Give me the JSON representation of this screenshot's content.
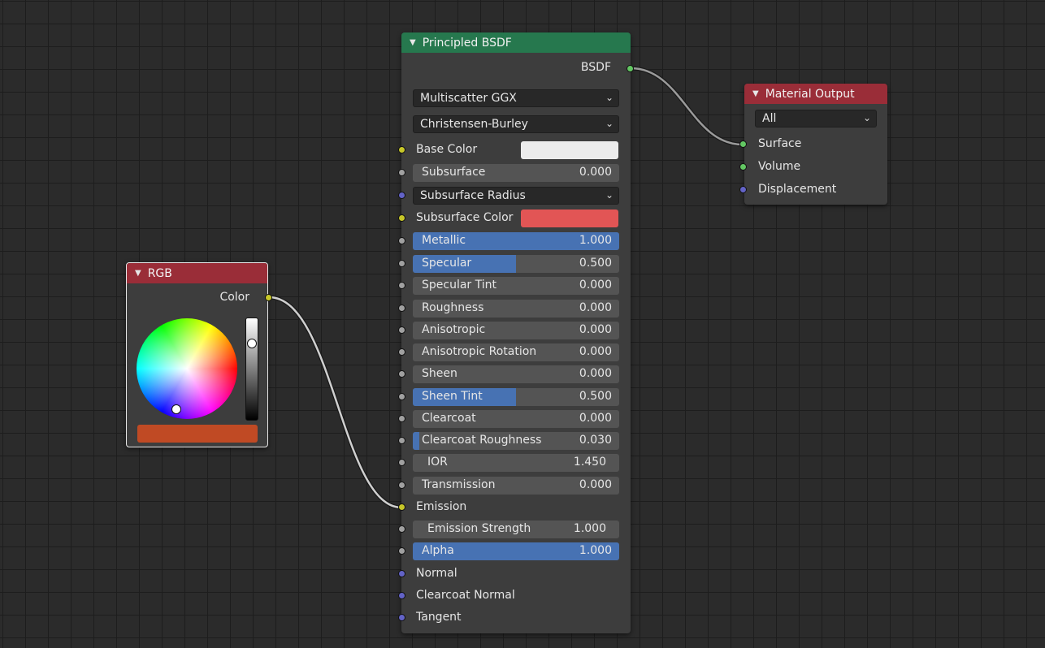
{
  "nodes": {
    "principled": {
      "title": "Principled BSDF",
      "header_color": "#26784e",
      "output_label": "BSDF",
      "distribution": "Multiscatter GGX",
      "subsurface_method": "Christensen-Burley",
      "inputs": [
        {
          "key": "base_color",
          "label": "Base Color",
          "kind": "color",
          "socket": "yellow",
          "color": "#ececec"
        },
        {
          "key": "subsurface",
          "label": "Subsurface",
          "kind": "slider",
          "socket": "grey",
          "value": "0.000",
          "fill": 0
        },
        {
          "key": "subsurface_radius",
          "label": "Subsurface Radius",
          "kind": "dropdown",
          "socket": "blue"
        },
        {
          "key": "subsurface_color",
          "label": "Subsurface Color",
          "kind": "color",
          "socket": "yellow",
          "color": "#e25555"
        },
        {
          "key": "metallic",
          "label": "Metallic",
          "kind": "slider",
          "socket": "grey",
          "value": "1.000",
          "fill": 1
        },
        {
          "key": "specular",
          "label": "Specular",
          "kind": "slider",
          "socket": "grey",
          "value": "0.500",
          "fill": 0.5
        },
        {
          "key": "specular_tint",
          "label": "Specular Tint",
          "kind": "slider",
          "socket": "grey",
          "value": "0.000",
          "fill": 0
        },
        {
          "key": "roughness",
          "label": "Roughness",
          "kind": "slider",
          "socket": "grey",
          "value": "0.000",
          "fill": 0
        },
        {
          "key": "anisotropic",
          "label": "Anisotropic",
          "kind": "slider",
          "socket": "grey",
          "value": "0.000",
          "fill": 0
        },
        {
          "key": "anisotropic_rotation",
          "label": "Anisotropic Rotation",
          "kind": "slider",
          "socket": "grey",
          "value": "0.000",
          "fill": 0
        },
        {
          "key": "sheen",
          "label": "Sheen",
          "kind": "slider",
          "socket": "grey",
          "value": "0.000",
          "fill": 0
        },
        {
          "key": "sheen_tint",
          "label": "Sheen Tint",
          "kind": "slider",
          "socket": "grey",
          "value": "0.500",
          "fill": 0.5
        },
        {
          "key": "clearcoat",
          "label": "Clearcoat",
          "kind": "slider",
          "socket": "grey",
          "value": "0.000",
          "fill": 0
        },
        {
          "key": "clearcoat_roughness",
          "label": "Clearcoat Roughness",
          "kind": "slider",
          "socket": "grey",
          "value": "0.030",
          "fill": 0.03
        },
        {
          "key": "ior",
          "label": "IOR",
          "kind": "number",
          "socket": "grey",
          "value": "1.450"
        },
        {
          "key": "transmission",
          "label": "Transmission",
          "kind": "slider",
          "socket": "grey",
          "value": "0.000",
          "fill": 0
        },
        {
          "key": "emission",
          "label": "Emission",
          "kind": "label",
          "socket": "yellow"
        },
        {
          "key": "emission_strength",
          "label": "Emission Strength",
          "kind": "number",
          "socket": "grey",
          "value": "1.000"
        },
        {
          "key": "alpha",
          "label": "Alpha",
          "kind": "slider",
          "socket": "grey",
          "value": "1.000",
          "fill": 1
        },
        {
          "key": "normal",
          "label": "Normal",
          "kind": "label",
          "socket": "blue"
        },
        {
          "key": "clearcoat_normal",
          "label": "Clearcoat Normal",
          "kind": "label",
          "socket": "blue"
        },
        {
          "key": "tangent",
          "label": "Tangent",
          "kind": "label",
          "socket": "blue"
        }
      ]
    },
    "material_output": {
      "title": "Material Output",
      "header_color": "#9a2d38",
      "target": "All",
      "inputs": [
        {
          "label": "Surface",
          "socket": "green"
        },
        {
          "label": "Volume",
          "socket": "green"
        },
        {
          "label": "Displacement",
          "socket": "blue"
        }
      ]
    },
    "rgb": {
      "title": "RGB",
      "header_color": "#9a2d38",
      "output_label": "Color",
      "color": "#c04a24",
      "value_level": 0.75
    }
  },
  "colors": {
    "socket_yellow": "#c7c729",
    "socket_grey": "#a1a1a1",
    "socket_blue": "#6363c7",
    "socket_green": "#63c763",
    "slider_fill": "#4772b3"
  }
}
